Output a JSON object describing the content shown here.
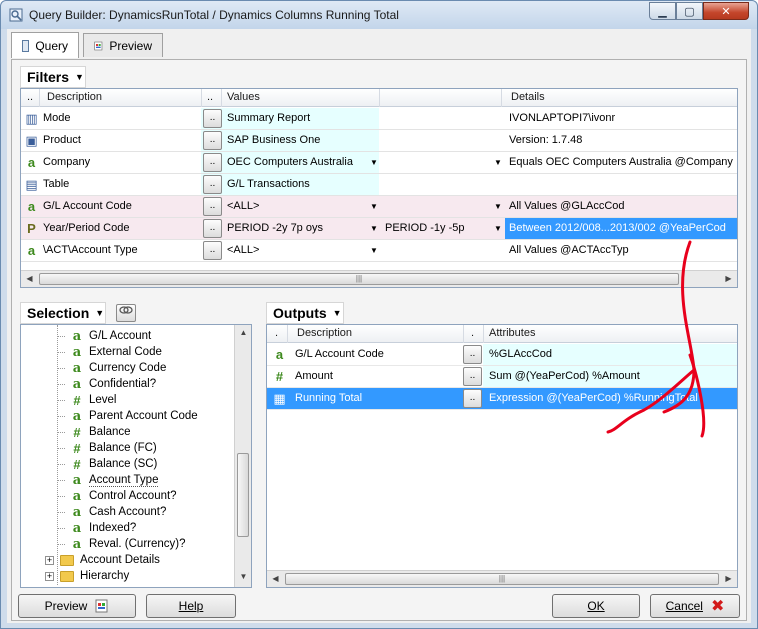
{
  "window": {
    "title": "Query Builder: DynamicsRunTotal / Dynamics Columns Running Total",
    "controls": {
      "minimize": "▁",
      "maximize": "▢",
      "close": "✕"
    }
  },
  "tabs": [
    {
      "label": "Query",
      "active": true
    },
    {
      "label": "Preview",
      "active": false
    }
  ],
  "filters": {
    "label": "Filters",
    "columns": {
      "dots1": "..",
      "description": "Description",
      "dots2": "..",
      "values": "Values",
      "details": "Details"
    },
    "rows": [
      {
        "icon": "chart-icon",
        "glyph": "▥",
        "description": "Mode",
        "value1": "Summary Report",
        "value2": "",
        "details": "IVONLAPTOPI7\\ivonr",
        "has_dropdown": false,
        "highlight": "cyan",
        "selected_details": false
      },
      {
        "icon": "product-icon",
        "glyph": "▣",
        "description": "Product",
        "value1": "SAP Business One",
        "value2": "",
        "details": "Version: 1.7.48",
        "has_dropdown": false,
        "highlight": "cyan",
        "selected_details": false
      },
      {
        "icon": "text-field-icon",
        "glyph": "a",
        "description": "Company",
        "value1": "OEC Computers Australia",
        "value2": "",
        "details": "Equals OEC Computers Australia @Company",
        "has_dropdown": true,
        "highlight": "cyan",
        "selected_details": false
      },
      {
        "icon": "table-icon",
        "glyph": "▤",
        "description": "Table",
        "value1": "G/L Transactions",
        "value2": "",
        "details": "",
        "has_dropdown": false,
        "highlight": "cyan",
        "selected_details": false
      },
      {
        "icon": "text-field-icon",
        "glyph": "a",
        "description": "G/L Account Code",
        "value1": "<ALL>",
        "value2": "",
        "details": "All Values @GLAccCod",
        "has_dropdown": true,
        "highlight": "pink",
        "selected_details": false
      },
      {
        "icon": "period-icon",
        "glyph": "P",
        "description": "Year/Period Code",
        "value1": "PERIOD -2y 7p oys",
        "value2": "PERIOD -1y -5p",
        "details": "Between 2012/008...2013/002 @YeaPerCod",
        "has_dropdown": true,
        "highlight": "pink",
        "selected_details": true
      },
      {
        "icon": "text-field-icon",
        "glyph": "a",
        "description": "\\ACT\\Account Type",
        "value1": "<ALL>",
        "value2": "",
        "details": "All Values @ACTAccTyp",
        "has_dropdown": true,
        "highlight": "none",
        "selected_details": false
      }
    ]
  },
  "selection": {
    "label": "Selection",
    "items": [
      {
        "glyph": "a",
        "kind": "a",
        "label": "G/L Account",
        "underline": false
      },
      {
        "glyph": "a",
        "kind": "a",
        "label": "External Code",
        "underline": false
      },
      {
        "glyph": "a",
        "kind": "a",
        "label": "Currency Code",
        "underline": false
      },
      {
        "glyph": "a",
        "kind": "a",
        "label": "Confidential?",
        "underline": false
      },
      {
        "glyph": "#",
        "kind": "hash",
        "label": "Level",
        "underline": false
      },
      {
        "glyph": "a",
        "kind": "a",
        "label": "Parent Account Code",
        "underline": false
      },
      {
        "glyph": "#",
        "kind": "hash",
        "label": "Balance",
        "underline": false
      },
      {
        "glyph": "#",
        "kind": "hash",
        "label": "Balance (FC)",
        "underline": false
      },
      {
        "glyph": "#",
        "kind": "hash",
        "label": "Balance (SC)",
        "underline": false
      },
      {
        "glyph": "a",
        "kind": "a",
        "label": "Account Type",
        "underline": true
      },
      {
        "glyph": "a",
        "kind": "a",
        "label": "Control Account?",
        "underline": false
      },
      {
        "glyph": "a",
        "kind": "a",
        "label": "Cash Account?",
        "underline": false
      },
      {
        "glyph": "a",
        "kind": "a",
        "label": "Indexed?",
        "underline": false
      },
      {
        "glyph": "a",
        "kind": "a",
        "label": "Reval. (Currency)?",
        "underline": false
      },
      {
        "glyph": "+",
        "kind": "folder",
        "label": "Account Details",
        "underline": false
      },
      {
        "glyph": "+",
        "kind": "folder",
        "label": "Hierarchy",
        "underline": false
      }
    ]
  },
  "outputs": {
    "label": "Outputs",
    "columns": {
      "dot": ".",
      "description": "Description",
      "dot2": ".",
      "attributes": "Attributes"
    },
    "rows": [
      {
        "glyph": "a",
        "kind": "a",
        "description": "G/L Account Code",
        "attributes": "%GLAccCod",
        "selected": false
      },
      {
        "glyph": "#",
        "kind": "hash",
        "description": "Amount",
        "attributes": "Sum @(YeaPerCod) %Amount",
        "selected": false
      },
      {
        "glyph": "▦",
        "kind": "calc",
        "description": "Running Total",
        "attributes": "Expression @(YeaPerCod) %RunningTotal",
        "selected": true
      }
    ]
  },
  "buttons": {
    "preview": "Preview",
    "help": "Help",
    "ok": "OK",
    "cancel": "Cancel",
    "cell_dots": "..",
    "dropdown_arrow": "▼"
  },
  "colors": {
    "cyan_cell": "#e6ffff",
    "pink_row": "#f7e9ef",
    "selection_blue": "#3399ff",
    "annotation_red": "#e8001c"
  }
}
